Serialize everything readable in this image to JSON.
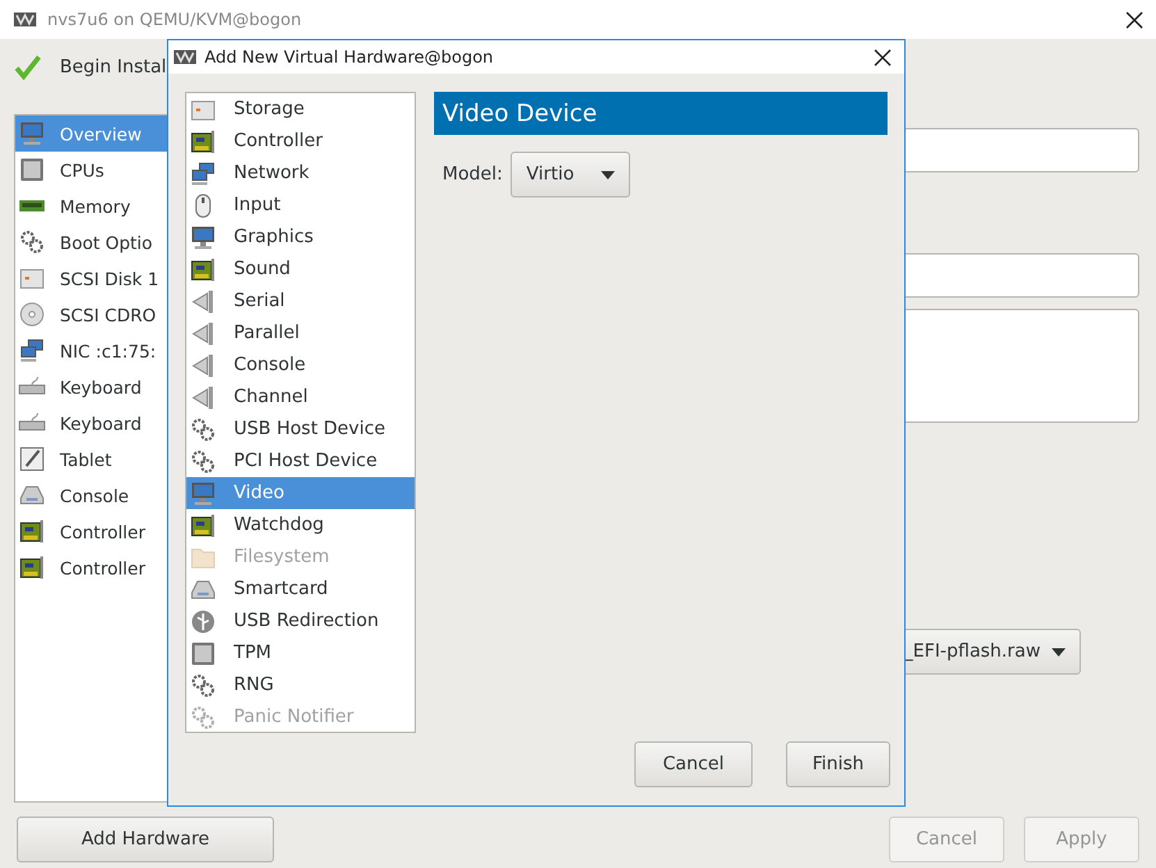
{
  "window": {
    "title": "nvs7u6 on QEMU/KVM@bogon"
  },
  "toolbar": {
    "begin_install": "Begin Instal"
  },
  "sidebar": {
    "items": [
      {
        "label": "Overview",
        "kind": "monitor",
        "selected": true
      },
      {
        "label": "CPUs",
        "kind": "chip",
        "selected": false
      },
      {
        "label": "Memory",
        "kind": "memory",
        "selected": false
      },
      {
        "label": "Boot Optio",
        "kind": "gears",
        "selected": false
      },
      {
        "label": "SCSI Disk 1",
        "kind": "drive",
        "selected": false
      },
      {
        "label": "SCSI CDRO",
        "kind": "disc",
        "selected": false
      },
      {
        "label": "NIC :c1:75:",
        "kind": "network",
        "selected": false
      },
      {
        "label": "Keyboard",
        "kind": "keyboard",
        "selected": false
      },
      {
        "label": "Keyboard",
        "kind": "keyboard",
        "selected": false
      },
      {
        "label": "Tablet",
        "kind": "tablet",
        "selected": false
      },
      {
        "label": "Console",
        "kind": "reader",
        "selected": false
      },
      {
        "label": "Controller",
        "kind": "card",
        "selected": false
      },
      {
        "label": "Controller",
        "kind": "card",
        "selected": false
      }
    ]
  },
  "details": {
    "firmware": "_EFI-pflash.raw"
  },
  "add_hardware": "Add Hardware",
  "buttons": [
    {
      "label": "Cancel",
      "disabled": true
    },
    {
      "label": "Apply",
      "disabled": true
    }
  ],
  "dialog": {
    "title": "Add New Virtual Hardware@bogon",
    "categories": [
      {
        "label": "Storage",
        "kind": "drive",
        "selected": false,
        "disabled": false
      },
      {
        "label": "Controller",
        "kind": "card",
        "selected": false,
        "disabled": false
      },
      {
        "label": "Network",
        "kind": "network",
        "selected": false,
        "disabled": false
      },
      {
        "label": "Input",
        "kind": "mouse",
        "selected": false,
        "disabled": false
      },
      {
        "label": "Graphics",
        "kind": "monitor",
        "selected": false,
        "disabled": false
      },
      {
        "label": "Sound",
        "kind": "card",
        "selected": false,
        "disabled": false
      },
      {
        "label": "Serial",
        "kind": "plug",
        "selected": false,
        "disabled": false
      },
      {
        "label": "Parallel",
        "kind": "plug",
        "selected": false,
        "disabled": false
      },
      {
        "label": "Console",
        "kind": "plug",
        "selected": false,
        "disabled": false
      },
      {
        "label": "Channel",
        "kind": "plug",
        "selected": false,
        "disabled": false
      },
      {
        "label": "USB Host Device",
        "kind": "gears",
        "selected": false,
        "disabled": false
      },
      {
        "label": "PCI Host Device",
        "kind": "gears",
        "selected": false,
        "disabled": false
      },
      {
        "label": "Video",
        "kind": "monitor",
        "selected": true,
        "disabled": false
      },
      {
        "label": "Watchdog",
        "kind": "card",
        "selected": false,
        "disabled": false
      },
      {
        "label": "Filesystem",
        "kind": "folder",
        "selected": false,
        "disabled": true
      },
      {
        "label": "Smartcard",
        "kind": "reader",
        "selected": false,
        "disabled": false
      },
      {
        "label": "USB Redirection",
        "kind": "usb",
        "selected": false,
        "disabled": false
      },
      {
        "label": "TPM",
        "kind": "chip",
        "selected": false,
        "disabled": false
      },
      {
        "label": "RNG",
        "kind": "gears",
        "selected": false,
        "disabled": false
      },
      {
        "label": "Panic Notifier",
        "kind": "gears",
        "selected": false,
        "disabled": true
      }
    ],
    "section_title": "Video Device",
    "model": {
      "label": "Model:",
      "value": "Virtio"
    },
    "buttons": [
      "Cancel",
      "Finish"
    ]
  }
}
